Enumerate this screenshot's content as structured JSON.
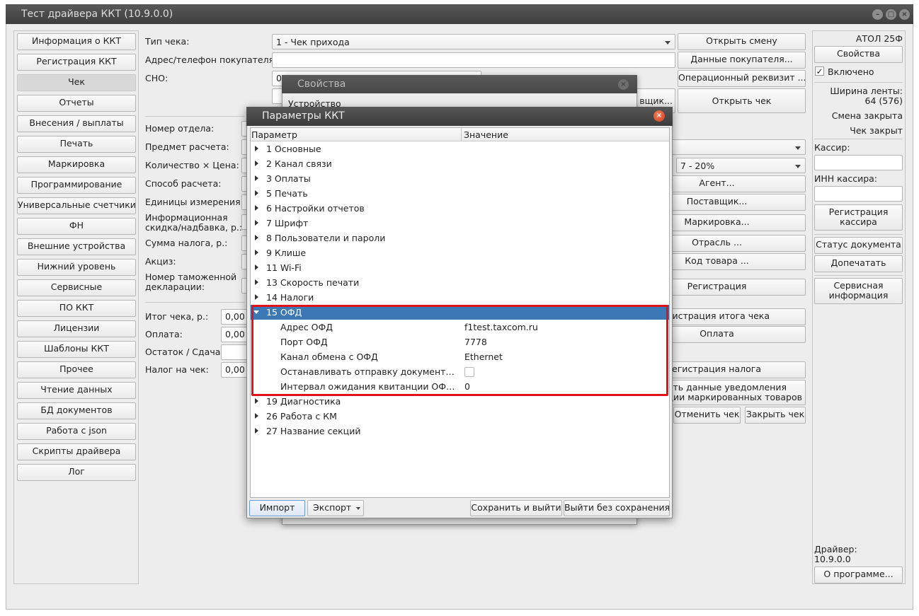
{
  "window": {
    "title": "Тест драйвера ККТ (10.9.0.0)"
  },
  "sidebar": {
    "items": [
      {
        "label": "Информация о ККТ"
      },
      {
        "label": "Регистрация ККТ"
      },
      {
        "label": "Чек",
        "active": true
      },
      {
        "label": "Отчеты"
      },
      {
        "label": "Внесения / выплаты"
      },
      {
        "label": "Печать"
      },
      {
        "label": "Маркировка"
      },
      {
        "label": "Программирование"
      },
      {
        "label": "Универсальные счетчики"
      },
      {
        "label": "ФН"
      },
      {
        "label": "Внешние устройства"
      },
      {
        "label": "Нижний уровень"
      },
      {
        "label": "Сервисные"
      },
      {
        "label": "ПО ККТ"
      },
      {
        "label": "Лицензии"
      },
      {
        "label": "Шаблоны ККТ"
      },
      {
        "label": "Прочее"
      },
      {
        "label": "Чтение данных"
      },
      {
        "label": "БД документов"
      },
      {
        "label": "Работа с json"
      },
      {
        "label": "Скрипты драйвера"
      },
      {
        "label": "Лог"
      }
    ]
  },
  "form": {
    "receipt_type_label": "Тип чека:",
    "receipt_type_value": "1 - Чек прихода",
    "buyer_address_label": "Адрес/телефон покупателя:",
    "buyer_address_value": "",
    "sno_label": "СНО:",
    "sno_value": "0",
    "department_label": "Номер отдела:",
    "subject_label": "Предмет расчета:",
    "qty_price_label": "Количество × Цена:",
    "payment_method_label": "Способ расчета:",
    "units_label": "Единицы измерения:",
    "info_discount_label_1": "Информационная",
    "info_discount_label_2": "скидка/надбавка, р.:",
    "tax_sum_label": "Сумма налога, р.:",
    "excise_label": "Акциз:",
    "customs_label_1": "Номер таможенной",
    "customs_label_2": "декларации:",
    "total_label": "Итог чека, р.:",
    "total_value": "0,00",
    "payment_label": "Оплата:",
    "payment_value": "0,00",
    "change_label": "Остаток / Сдача:",
    "change_value": "",
    "tax_on_receipt_label": "Налог на чек:",
    "tax_on_receipt_value": "0,00",
    "vat_value": "7 - 20%"
  },
  "actions": {
    "open_shift": "Открыть смену",
    "buyer_data": "Данные покупателя...",
    "operational_requisite": "Операционный реквизит ...",
    "open_receipt": "Открыть чек",
    "supplier_partial": "вщик...",
    "agent": "Агент...",
    "supplier": "Поставщик...",
    "marking": "Маркировка...",
    "industry": "Отрасль ...",
    "product_code": "Код товара ...",
    "registration": "Регистрация",
    "total_registration": "Регистрация итога чека",
    "payment": "Оплата",
    "tax_registration": "Регистрация налога",
    "notification_line1": "дать данные уведомления",
    "notification_line2": "ации маркированных товаров",
    "cancel_receipt": "Отменить чек",
    "close_receipt": "Закрыть чек"
  },
  "right_panel": {
    "device_name": "АТОЛ 25Ф",
    "properties_button": "Свойства",
    "enabled_label": "Включено",
    "enabled_checked": true,
    "tape_width_label": "Ширина ленты:",
    "tape_width_value": "64 (576)",
    "shift_status": "Смена закрыта",
    "receipt_status": "Чек закрыт",
    "cashier_label": "Кассир:",
    "cashier_value": "",
    "cashier_inn_label": "ИНН кассира:",
    "cashier_inn_value": "",
    "register_cashier_line1": "Регистрация",
    "register_cashier_line2": "кассира",
    "document_status": "Статус документа",
    "reprint": "Допечатать",
    "service_info_line1": "Сервисная",
    "service_info_line2": "информация",
    "driver_label": "Драйвер:",
    "driver_version": "10.9.0.0",
    "about_button": "О программе..."
  },
  "properties_dialog": {
    "title": "Свойства",
    "device_tab": "Устройство"
  },
  "params_dialog": {
    "title": "Параметры ККТ",
    "col_param": "Параметр",
    "col_value": "Значение",
    "groups_before": [
      {
        "label": "1 Основные"
      },
      {
        "label": "2 Канал связи"
      },
      {
        "label": "3 Оплаты"
      },
      {
        "label": "5 Печать"
      },
      {
        "label": "6 Настройки отчетов"
      },
      {
        "label": "7 Шрифт"
      },
      {
        "label": "8 Пользователи и пароли"
      },
      {
        "label": "9 Клише"
      },
      {
        "label": "11 Wi-Fi"
      },
      {
        "label": "13 Скорость печати"
      },
      {
        "label": "14 Налоги"
      }
    ],
    "expanded_group": "15 ОФД",
    "ofd_params": [
      {
        "name": "Адрес ОФД",
        "value": "f1test.taxcom.ru"
      },
      {
        "name": "Порт ОФД",
        "value": "7778"
      },
      {
        "name": "Канал обмена с ОФД",
        "value": "Ethernet"
      },
      {
        "name": "Останавливать отправку документов в ОФД",
        "value": "",
        "checkbox": true,
        "checked": false
      },
      {
        "name": "Интервал ожидания квитанции ОФД (с)",
        "value": "0"
      }
    ],
    "groups_after": [
      {
        "label": "19 Диагностика"
      },
      {
        "label": "26 Работа с КМ"
      },
      {
        "label": "27 Название секций"
      }
    ],
    "import_button": "Импорт",
    "export_button": "Экспорт",
    "save_exit_button": "Сохранить и выйти",
    "exit_no_save_button": "Выйти без сохранения"
  }
}
